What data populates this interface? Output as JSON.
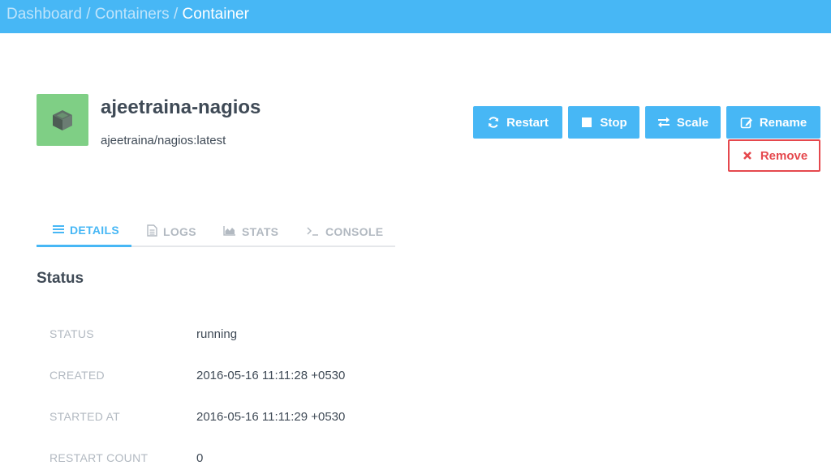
{
  "breadcrumb": {
    "items": [
      "Dashboard",
      "Containers",
      "Container"
    ],
    "separator": "/"
  },
  "container": {
    "name": "ajeetraina-nagios",
    "image": "ajeetraina/nagios:latest",
    "avatar_icon": "cube-icon"
  },
  "actions": {
    "restart": "Restart",
    "stop": "Stop",
    "scale": "Scale",
    "rename": "Rename",
    "remove": "Remove"
  },
  "tabs": [
    {
      "label": "DETAILS",
      "icon": "list-icon",
      "active": true
    },
    {
      "label": "LOGS",
      "icon": "file-icon",
      "active": false
    },
    {
      "label": "STATS",
      "icon": "area-chart-icon",
      "active": false
    },
    {
      "label": "CONSOLE",
      "icon": "terminal-icon",
      "active": false
    }
  ],
  "status_section": {
    "title": "Status",
    "rows": [
      {
        "label": "STATUS",
        "value": "running"
      },
      {
        "label": "CREATED",
        "value": "2016-05-16 11:11:28 +0530"
      },
      {
        "label": "STARTED AT",
        "value": "2016-05-16 11:11:29 +0530"
      },
      {
        "label": "RESTART COUNT",
        "value": "0"
      }
    ]
  },
  "colors": {
    "accent": "#47b7f5",
    "danger": "#e5484d",
    "avatar": "#7fcf85"
  }
}
